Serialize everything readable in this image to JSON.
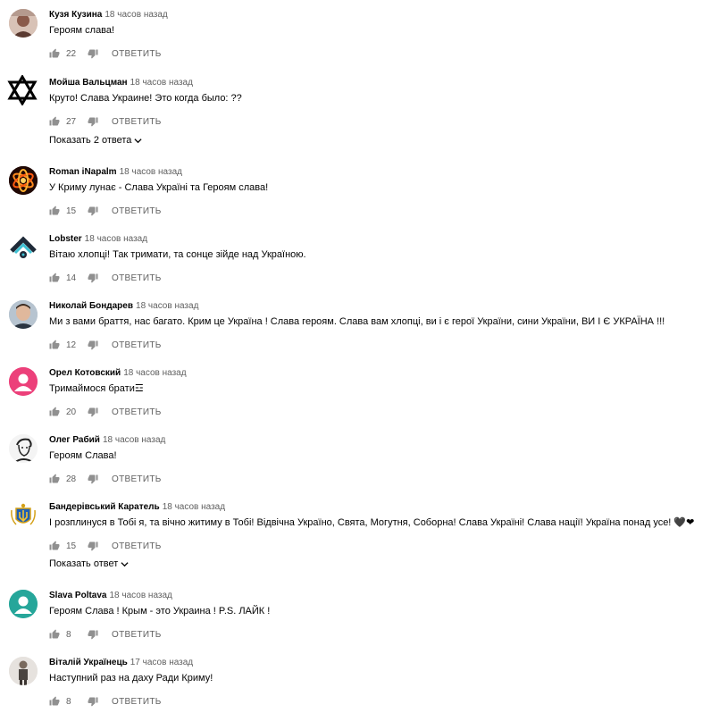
{
  "labels": {
    "reply": "ОТВЕТИТЬ"
  },
  "comments": [
    {
      "author": "Кузя Кузина",
      "time": "18 часов назад",
      "text": "Героям слава!",
      "likes": "22",
      "avatar_icon": "photo-avatar"
    },
    {
      "author": "Мойша Вальцман",
      "time": "18 часов назад",
      "text": "Круто! Слава Украине! Это когда было: ??",
      "likes": "27",
      "avatar_icon": "star-of-david-icon",
      "replies_toggle": "Показать 2 ответа"
    },
    {
      "author": "Roman iNapalm",
      "time": "18 часов назад",
      "text": "У Криму лунає - Слава Україні та Героям слава!",
      "likes": "15",
      "avatar_icon": "fire-atom-avatar"
    },
    {
      "author": "Lobster",
      "time": "18 часов назад",
      "text": "Вітаю хлопці! Так тримати, та сонце зійде над Україною.",
      "likes": "14",
      "avatar_icon": "chevron-eye-avatar"
    },
    {
      "author": "Николай Бондарев",
      "time": "18 часов назад",
      "text": "Ми з вами браття, нас багато. Крим це Україна ! Слава героям. Слава вам хлопці, ви і є герої України, сини України, ВИ І Є УКРАЇНА !!!",
      "likes": "12",
      "avatar_icon": "photo-avatar"
    },
    {
      "author": "Орел Котовский",
      "time": "18 часов назад",
      "text": "Тримаймося брати☲",
      "likes": "20",
      "avatar_icon": "default-user-avatar"
    },
    {
      "author": "Олег Рабий",
      "time": "18 часов назад",
      "text": "Героям Слава!",
      "likes": "28",
      "avatar_icon": "sketch-portrait-avatar"
    },
    {
      "author": "Бандерівський Каратель",
      "time": "18 часов назад",
      "text": "І розплинуся в Тобі я, та вічно житиму в Тобі! Відвічна Україно, Свята, Могутня, Соборна! Слава Україні! Слава нації! Україна понад усе! 🖤❤",
      "likes": "15",
      "avatar_icon": "ukraine-coat-of-arms-avatar",
      "replies_toggle": "Показать ответ"
    },
    {
      "author": "Slava Poltava",
      "time": "18 часов назад",
      "text": "Героям Слава ! Крым - это Украина !  P.S. ЛАЙК !",
      "likes": "8",
      "avatar_icon": "default-user-avatar"
    },
    {
      "author": "Віталій Українець",
      "time": "17 часов назад",
      "text": "Наступний раз на даху Ради Криму!",
      "likes": "8",
      "avatar_icon": "photo-avatar"
    }
  ],
  "colors": {
    "author": "#030303",
    "meta": "#606060",
    "avatar_pink": "#ec407a",
    "avatar_teal": "#26a69a"
  }
}
